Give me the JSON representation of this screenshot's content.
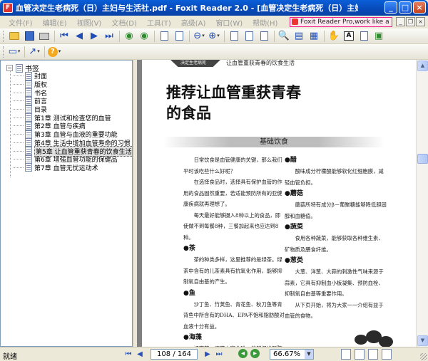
{
  "window": {
    "title": "血管决定生老病死（日）主妇与生活社.pdf - Foxit Reader 2.0 - [血管决定生老病死（日）主妇与生活社.pdf]",
    "buttons": {
      "minimize": "_",
      "maximize": "□",
      "close": "×"
    }
  },
  "menubar": {
    "items": [
      "文件(F)",
      "编辑(E)",
      "视图(V)",
      "文档(D)",
      "工具(T)",
      "高级(A)",
      "窗口(W)",
      "帮助(H)"
    ],
    "promo": "Foxit Reader Pro,work like a pro!"
  },
  "toolbar": {
    "icons": [
      "open-icon",
      "save-icon",
      "print-icon",
      "first-page-icon",
      "prev-page-icon",
      "next-page-icon",
      "last-page-icon",
      "back-icon",
      "forward-icon",
      "rotate-icon",
      "zoom-out-icon",
      "zoom-in-icon",
      "single-page-icon",
      "facing-page-icon",
      "fit-width-icon",
      "find-icon",
      "bookmarks-icon",
      "thumbnails-icon",
      "hand-icon",
      "select-text-icon",
      "snapshot-icon",
      "typewriter-icon"
    ]
  },
  "bookmarks": {
    "root": "书签",
    "items": [
      "封面",
      "版权",
      "书名",
      "前言",
      "目录",
      "第1章 测试和检查您的血管",
      "第2章 血管与疾病",
      "第3章 血管与血液的重要功能",
      "第4章 生活中增加血管寿命的习惯",
      "第5章 让血管重获青春的饮食生活",
      "第6章 增强血管功能的保健品",
      "第7章 血管无忧运动术"
    ],
    "selected_index": 9
  },
  "page": {
    "header_tag": "决定生老病死",
    "header_title": "让血管重获青春的饮食生活",
    "title_line1": "推荐让血管重获青春",
    "title_line2": "的食品",
    "section": "基础饮食",
    "left_column": [
      {
        "type": "para",
        "text": "日常饮食是血管健康的关键，那么我们平时该吃些什么好呢？"
      },
      {
        "type": "para",
        "text": "在选择食品时，选择具有保护血管的作用的食品固然重要，若适能预防所有的亚健康疾病就再理想了。"
      },
      {
        "type": "para",
        "text": "每天最好能够摄入8种以上的食品，即使做不到每餐8种，三餐加起来也应达到8种。"
      },
      {
        "type": "sub",
        "text": "●茶"
      },
      {
        "type": "para",
        "text": "茶的种类多样，这里推荐的是绿茶。绿茶中含有的儿茶素具有抗氧化作用，能够抑制氧自由基的产生。"
      },
      {
        "type": "sub",
        "text": "●鱼"
      },
      {
        "type": "para",
        "text": "沙丁鱼、竹荚鱼、青花鱼、秋刀鱼等青背鱼中所含有的DHA、EPA不饱和脂肪酸对血液十分有益。"
      },
      {
        "type": "sub",
        "text": "●海藻"
      },
      {
        "type": "para",
        "text": "裙带菜、海带中富含碘，能够促进新陈代谢，而其中的海藻成分具有降低胆固"
      }
    ],
    "right_column": [
      {
        "type": "sub",
        "text": "●醋"
      },
      {
        "type": "para",
        "text": "酸味成分柠檬酸能够软化红细胞膜，减轻血管负担。"
      },
      {
        "type": "sub",
        "text": "●蘑菇"
      },
      {
        "type": "para",
        "text": "蘑菇所特有成分β－葡聚糖能够降低胆固醇和血糖值。"
      },
      {
        "type": "sub",
        "text": "●蔬菜"
      },
      {
        "type": "para",
        "text": "食用各种蔬菜，能够获取各种维生素、矿物质及膳食纤维。"
      },
      {
        "type": "sub",
        "text": "●葱类"
      },
      {
        "type": "para",
        "text": "大葱、洋葱、大蒜的刺激性气味来源于蒜素，它具有抑制血小板凝集、预防血栓、抑制氧自由基等重要作用。"
      },
      {
        "type": "para",
        "text": "从下页开始，将为大家一一介绍有益于血管的食物。"
      }
    ]
  },
  "statusbar": {
    "status": "就绪",
    "page_indicator": "108 / 164",
    "zoom": "66.67%"
  }
}
